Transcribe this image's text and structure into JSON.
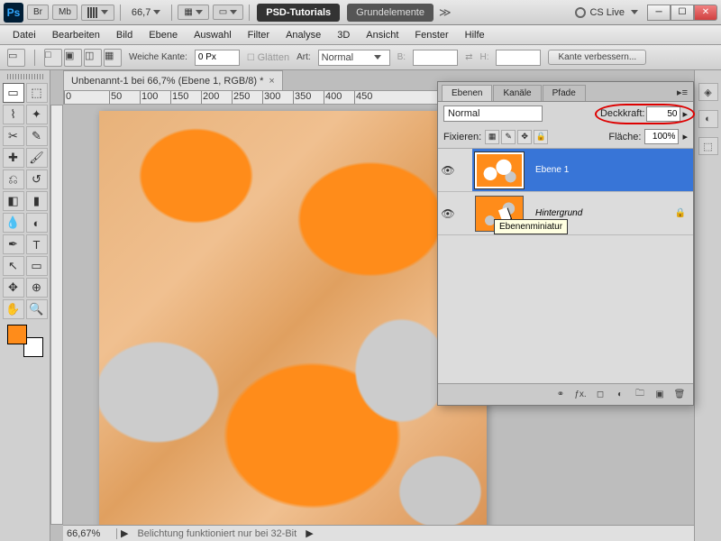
{
  "topbar": {
    "app": "Ps",
    "br": "Br",
    "mb": "Mb",
    "zoom": "66,7",
    "tab1": "PSD-Tutorials",
    "tab2": "Grundelemente",
    "cslive": "CS Live"
  },
  "menu": [
    "Datei",
    "Bearbeiten",
    "Bild",
    "Ebene",
    "Auswahl",
    "Filter",
    "Analyse",
    "3D",
    "Ansicht",
    "Fenster",
    "Hilfe"
  ],
  "options": {
    "feather_label": "Weiche Kante:",
    "feather_value": "0 Px",
    "antialias": "Glätten",
    "style_label": "Art:",
    "style_value": "Normal",
    "width_label": "B:",
    "height_label": "H:",
    "refine": "Kante verbessern..."
  },
  "document": {
    "tab_title": "Unbenannt-1 bei 66,7% (Ebene 1, RGB/8) *",
    "ruler_marks": [
      "0",
      "50",
      "100",
      "150",
      "200",
      "250",
      "300",
      "350",
      "400",
      "450"
    ]
  },
  "status": {
    "zoom": "66,67%",
    "message": "Belichtung funktioniert nur bei 32-Bit"
  },
  "layers_panel": {
    "tabs": [
      "Ebenen",
      "Kanäle",
      "Pfade"
    ],
    "blend_mode": "Normal",
    "opacity_label": "Deckkraft:",
    "opacity_value": "50",
    "lock_label": "Fixieren:",
    "fill_label": "Fläche:",
    "fill_value": "100%",
    "layers": [
      {
        "name": "Ebene 1",
        "visible": true,
        "selected": true
      },
      {
        "name": "Hintergrund",
        "visible": true,
        "locked": true,
        "italic": true
      }
    ],
    "tooltip": "Ebenenminiatur"
  },
  "swatches": {
    "fg": "#FF8C1A",
    "bg": "#FFFFFF"
  }
}
